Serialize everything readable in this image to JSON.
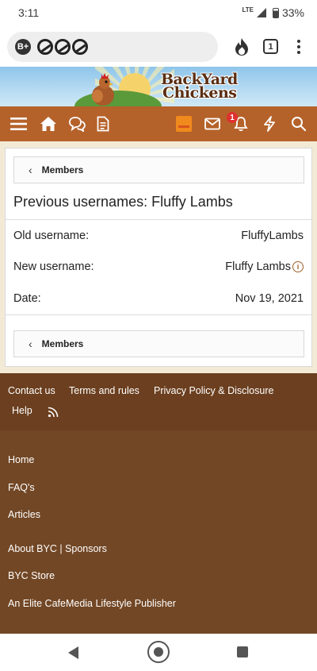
{
  "status_bar": {
    "time": "3:11",
    "network": "LTE",
    "battery": "33%"
  },
  "browser": {
    "brave_badge": "B+",
    "tab_count": "1"
  },
  "site": {
    "logo_line1": "BackYard",
    "logo_line2": "Chickens"
  },
  "nav": {
    "notification_count": "1"
  },
  "page": {
    "breadcrumb_top": "Members",
    "title": "Previous usernames: Fluffy Lambs",
    "rows": [
      {
        "label": "Old username:",
        "value": "FluffyLambs"
      },
      {
        "label": "New username:",
        "value": "Fluffy Lambs"
      },
      {
        "label": "Date:",
        "value": "Nov 19, 2021"
      }
    ],
    "breadcrumb_bottom": "Members"
  },
  "footer": {
    "links_top": [
      "Contact us",
      "Terms and rules",
      "Privacy Policy & Disclosure",
      "Help"
    ],
    "links_main": [
      "Home",
      "FAQ's",
      "Articles",
      "About BYC | Sponsors",
      "BYC Store",
      "An Elite CafeMedia Lifestyle Publisher"
    ]
  },
  "colors": {
    "nav_brown": "#b5622a",
    "footer_dark": "#6b3f1f",
    "footer_main": "#724725",
    "content_bg": "#f3ead6"
  }
}
